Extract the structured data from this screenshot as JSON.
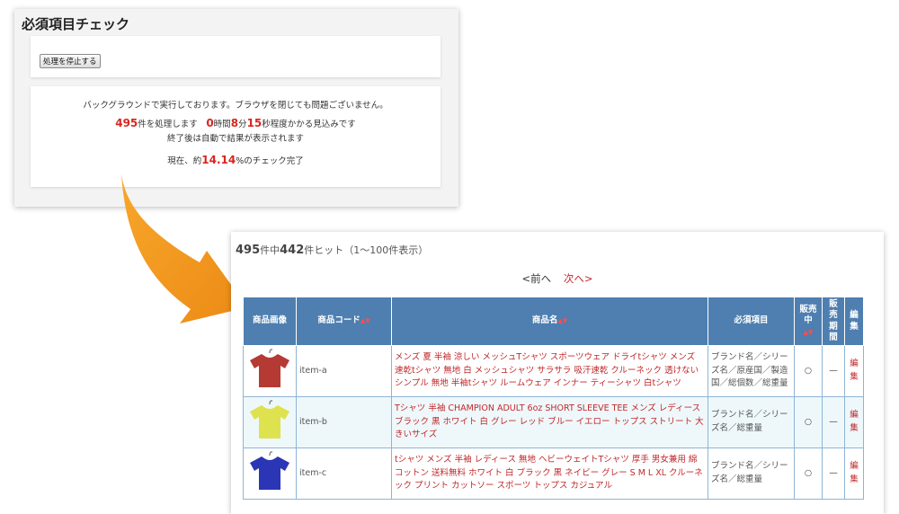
{
  "top_panel": {
    "title": "必須項目チェック",
    "stop_button": "処理を停止する",
    "bg_msg": "バックグラウンドで実行しております。ブラウザを閉じても問題ございません。",
    "count": "495",
    "count_suffix": "件を処理します",
    "hours": "0",
    "hours_unit": "時間",
    "minutes": "8",
    "minutes_unit": "分",
    "seconds": "15",
    "seconds_suffix": "秒程度かかる見込みです",
    "done_msg": "終了後は自動で結果が表示されます",
    "progress_prefix": "現在、約",
    "progress": "14.14",
    "progress_suffix": "%のチェック完了"
  },
  "results": {
    "total": "495",
    "total_suffix": "件中",
    "hits": "442",
    "hits_suffix": "件ヒット（1〜100件表示）",
    "prev": "<前へ",
    "next": "次へ>",
    "columns": {
      "image": "商品画像",
      "code": "商品コード",
      "name": "商品名",
      "required": "必須項目",
      "sale_1": "販売",
      "sale_2": "中",
      "period_1": "販",
      "period_2": "売",
      "period_3": "期",
      "period_4": "間",
      "edit_1": "編",
      "edit_2": "集"
    },
    "sort_mark": "▲▼",
    "rows": [
      {
        "shirt_color": "#b53a34",
        "code": "item-a",
        "name": "メンズ 夏 半袖 涼しい メッシュTシャツ スポーツウェア ドライtシャツ メンズ 速乾tシャツ 無地 白 メッシュシャツ サラサラ 吸汗速乾 クルーネック 透けない シンプル 無地 半袖tシャツ ルームウェア インナー ティーシャツ 白tシャツ",
        "required": "ブランド名／シリーズ名／原産国／製造国／総個数／総重量",
        "on_sale": "○",
        "period": "—",
        "edit_1": "編",
        "edit_2": "集"
      },
      {
        "shirt_color": "#dfe24f",
        "code": "item-b",
        "name": "Tシャツ 半袖 CHAMPION ADULT 6oz SHORT SLEEVE TEE メンズ レディース ブラック 黒 ホワイト 白 グレー レッド ブルー イエロー トップス ストリート 大きいサイズ",
        "required": "ブランド名／シリーズ名／総重量",
        "on_sale": "○",
        "period": "—",
        "edit_1": "編",
        "edit_2": "集"
      },
      {
        "shirt_color": "#2a36b5",
        "code": "item-c",
        "name": "tシャツ メンズ 半袖 レディース 無地 ヘビーウェイトTシャツ 厚手 男女兼用 綿 コットン 送料無料 ホワイト 白 ブラック 黒 ネイビー グレー S M L XL クルーネック プリント カットソー スポーツ トップス カジュアル",
        "required": "ブランド名／シリーズ名／総重量",
        "on_sale": "○",
        "period": "—",
        "edit_1": "編",
        "edit_2": "集"
      }
    ]
  }
}
